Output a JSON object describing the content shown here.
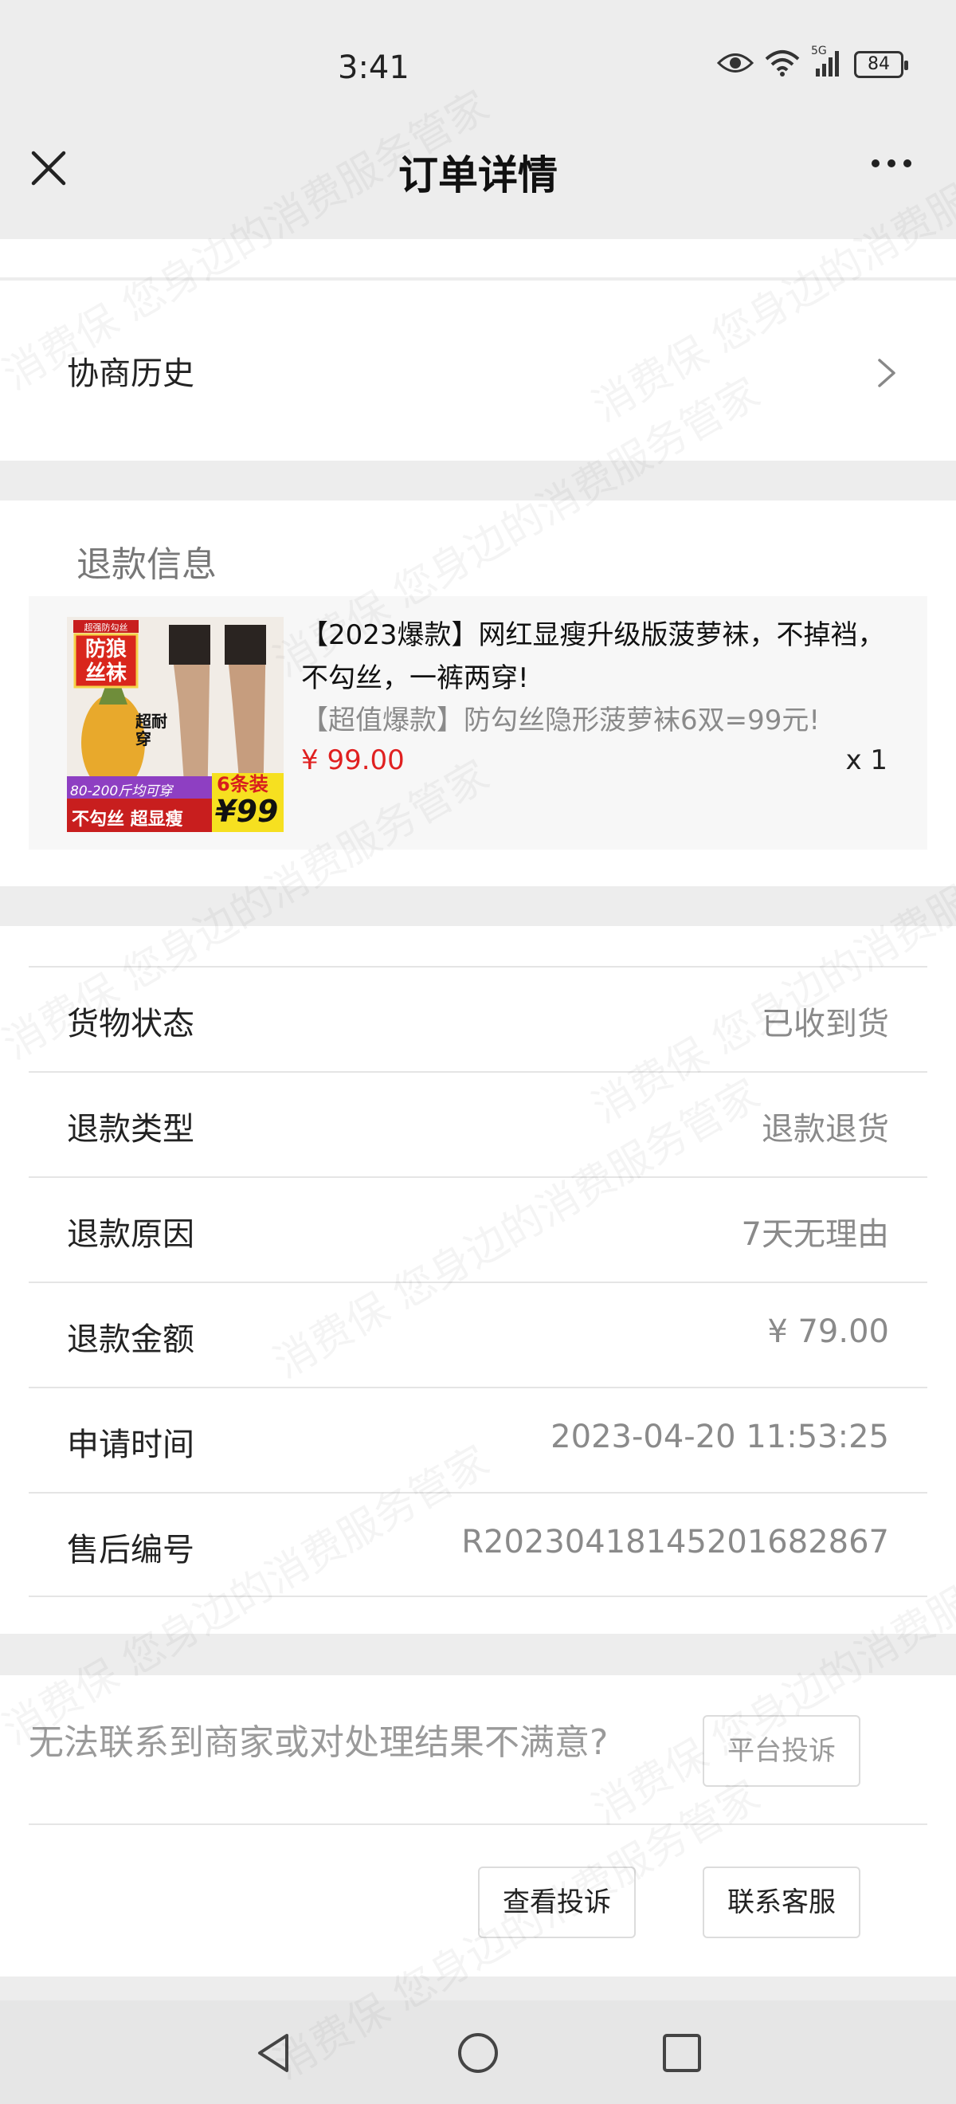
{
  "status_bar": {
    "time": "3:41",
    "network": "5G",
    "battery": "84"
  },
  "nav": {
    "title": "订单详情"
  },
  "history": {
    "label": "协商历史"
  },
  "refund_info": {
    "title": "退款信息",
    "product": {
      "name": "【2023爆款】网红显瘦升级版菠萝袜，不掉裆，不勾丝，一裤两穿!",
      "subtitle": "【超值爆款】防勾丝隐形菠萝袜6双=99元!",
      "price": "¥ 99.00",
      "quantity": "x 1",
      "image_texts": {
        "badge_top": "超强防勾丝",
        "badge": "防狼丝袜",
        "side": "超耐穿",
        "count": "6条装",
        "weight": "80-200斤均可穿",
        "bottom_left": "不勾丝 超显瘦",
        "price": "¥99"
      }
    }
  },
  "details": [
    {
      "label": "货物状态",
      "value": "已收到货"
    },
    {
      "label": "退款类型",
      "value": "退款退货"
    },
    {
      "label": "退款原因",
      "value": "7天无理由"
    },
    {
      "label": "退款金额",
      "value": "¥ 79.00"
    },
    {
      "label": "申请时间",
      "value": "2023-04-20 11:53:25"
    },
    {
      "label": "售后编号",
      "value": "R20230418145201682867"
    }
  ],
  "complaint": {
    "prompt": "无法联系到商家或对处理结果不满意?",
    "platform_button": "平台投诉",
    "view_button": "查看投诉",
    "service_button": "联系客服"
  },
  "watermark": "消费保 您身边的消费服务管家",
  "colors": {
    "price_red": "#e02020",
    "background": "#ededed"
  }
}
